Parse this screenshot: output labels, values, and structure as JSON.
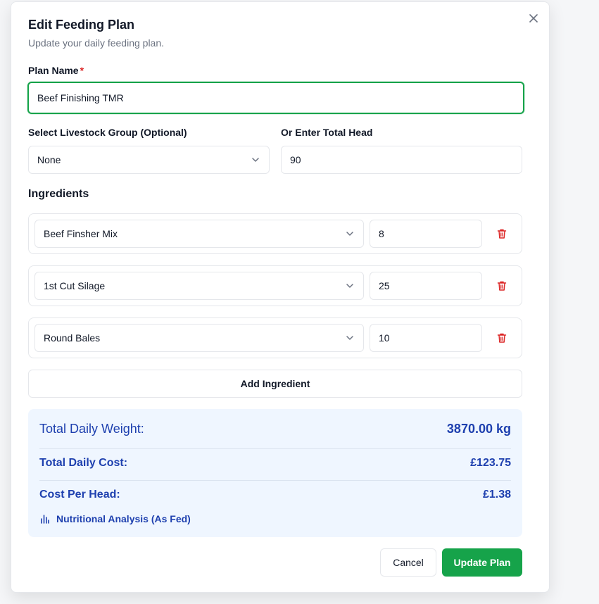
{
  "modal": {
    "title": "Edit Feeding Plan",
    "subtitle": "Update your daily feeding plan."
  },
  "plan_name": {
    "label": "Plan Name",
    "required_mark": "*",
    "value": "Beef Finishing TMR"
  },
  "livestock_group": {
    "label": "Select Livestock Group (Optional)",
    "value": "None"
  },
  "total_head": {
    "label": "Or Enter Total Head",
    "value": "90"
  },
  "ingredients": {
    "title": "Ingredients",
    "items": [
      {
        "name": "Beef Finsher Mix",
        "qty": "8"
      },
      {
        "name": "1st Cut Silage",
        "qty": "25"
      },
      {
        "name": "Round Bales",
        "qty": "10"
      }
    ],
    "add_label": "Add Ingredient"
  },
  "summary": {
    "weight_label": "Total Daily Weight:",
    "weight_value": "3870.00 kg",
    "cost_label": "Total Daily Cost:",
    "cost_value": "£123.75",
    "per_head_label": "Cost Per Head:",
    "per_head_value": "£1.38",
    "nutrition_label": "Nutritional Analysis (As Fed)"
  },
  "actions": {
    "cancel": "Cancel",
    "update": "Update Plan"
  },
  "colors": {
    "accent": "#16a34a",
    "summary_bg": "#eff6ff",
    "summary_text": "#1e40af",
    "danger": "#dc2626"
  },
  "icons": [
    "close-icon",
    "chevron-down-icon",
    "trash-icon",
    "bar-chart-icon"
  ]
}
